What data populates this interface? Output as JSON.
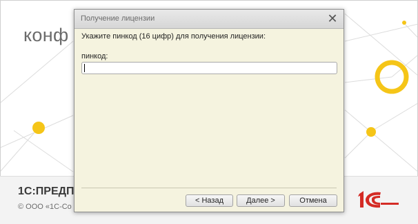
{
  "background": {
    "splash_word": "конф",
    "product_name": "1С:ПРЕДП",
    "copyright": "© ООО «1С-Со",
    "logo_text": "1С",
    "accent_yellow": "#f5c518",
    "logo_red": "#d42b25"
  },
  "dialog": {
    "title": "Получение лицензии",
    "close_icon": "close-icon",
    "prompt": "Укажите пинкод (16 цифр) для получения лицензии:",
    "pin_label": "пинкод:",
    "pin_value": "",
    "buttons": {
      "back": "< Назад",
      "next": "Далее >",
      "cancel": "Отмена"
    }
  }
}
